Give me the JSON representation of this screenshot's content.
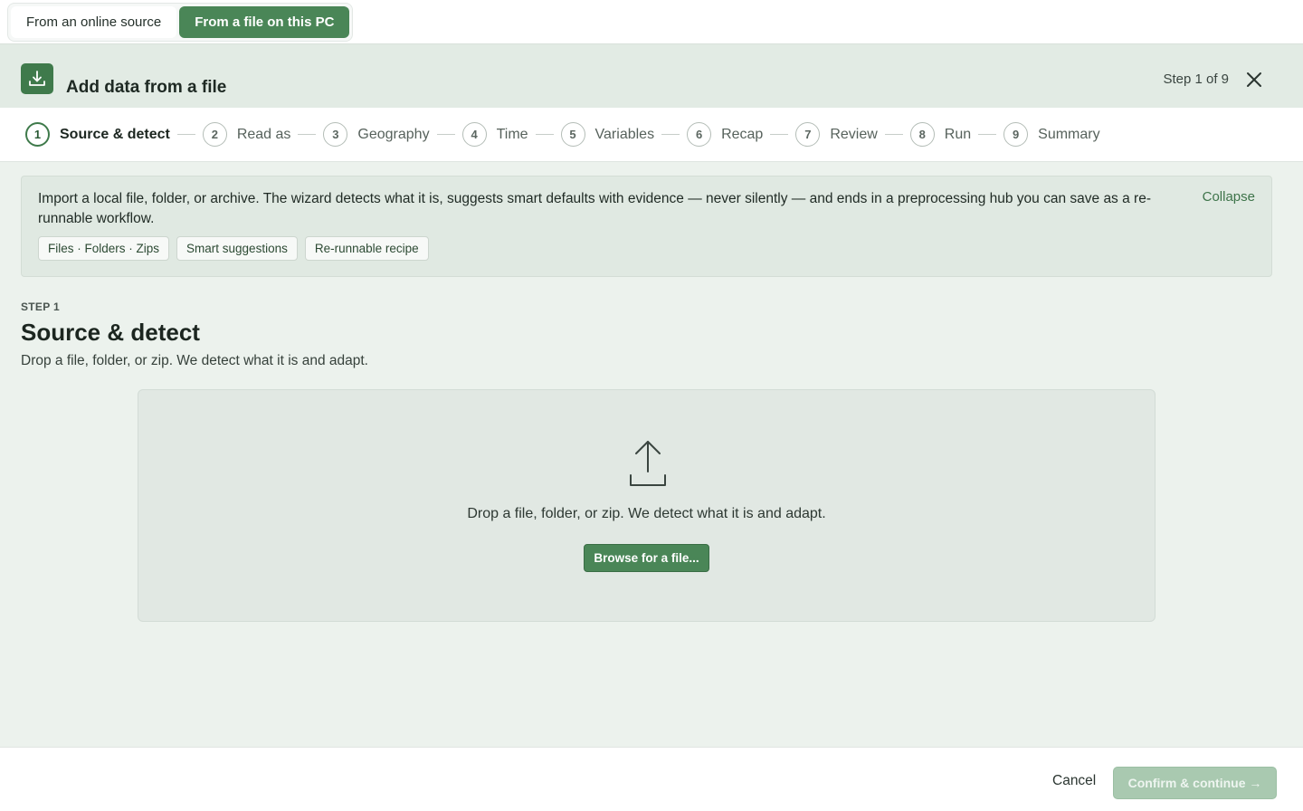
{
  "source_tabs": [
    {
      "label": "From an online source",
      "active": false
    },
    {
      "label": "From a file on this PC",
      "active": true
    }
  ],
  "header": {
    "title": "Add data from a file",
    "step_count": "Step 1 of 9",
    "icon": "download-icon"
  },
  "stepper": [
    {
      "num": "1",
      "label": "Source & detect",
      "active": true
    },
    {
      "num": "2",
      "label": "Read as",
      "active": false
    },
    {
      "num": "3",
      "label": "Geography",
      "active": false
    },
    {
      "num": "4",
      "label": "Time",
      "active": false
    },
    {
      "num": "5",
      "label": "Variables",
      "active": false
    },
    {
      "num": "6",
      "label": "Recap",
      "active": false
    },
    {
      "num": "7",
      "label": "Review",
      "active": false
    },
    {
      "num": "8",
      "label": "Run",
      "active": false
    },
    {
      "num": "9",
      "label": "Summary",
      "active": false
    }
  ],
  "info": {
    "text": "Import a local file, folder, or archive. The wizard detects what it is, suggests smart defaults with evidence — never silently — and ends in a preprocessing hub you can save as a re-runnable workflow.",
    "collapse_label": "Collapse",
    "chips": [
      "Files · Folders · Zips",
      "Smart suggestions",
      "Re-runnable recipe"
    ]
  },
  "step": {
    "eyebrow": "STEP 1",
    "heading": "Source & detect",
    "description": "Drop a file, folder, or zip. We detect what it is and adapt."
  },
  "dropzone": {
    "text": "Drop a file, folder, or zip. We detect what it is and adapt.",
    "browse_label": "Browse for a file...",
    "icon": "upload-icon"
  },
  "footer": {
    "cancel_label": "Cancel",
    "confirm_label": "Confirm & continue →"
  },
  "colors": {
    "accent": "#4a8657",
    "header_bg": "#e2ebe4",
    "main_bg": "#ecf2ed",
    "confirm_disabled": "#a9c9b0"
  }
}
